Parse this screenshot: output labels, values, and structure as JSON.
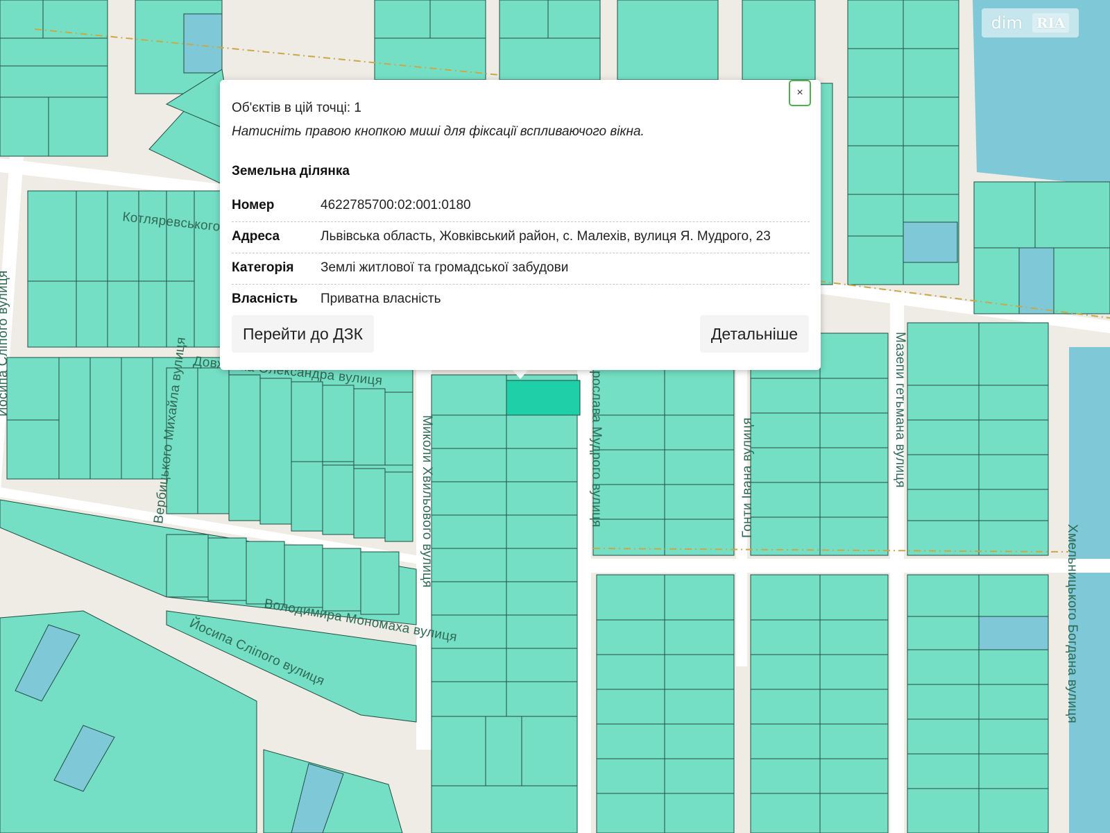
{
  "map": {
    "streets": [
      "Котляревського",
      "Довженка Олександра вулиця",
      "Вербицького Михайла вулиця",
      "Йосипа Сліпого вулиця",
      "Миколи Хвильового вулиця",
      "Володимира Мономаха вулиця",
      "Йосипа Сліпого вулиця",
      "Ярослава Мудрого вулиця",
      "Гонти Івана вулиця",
      "Мазепи гетьмана вулиця",
      "Хмельницького Богдана вулиця"
    ],
    "colors": {
      "parcel": "#75dfc5",
      "selected_parcel": "#1ecfa8",
      "water_parcel": "#7ec8d8",
      "road": "#ffffff",
      "background": "#efebe5"
    }
  },
  "logo": {
    "left": "dim",
    "right": "RIA"
  },
  "popup": {
    "close_label": "×",
    "count_text": "Об'єктів в цій точці: 1",
    "hint_text": "Натисніть правою кнопкою миші для фіксації вспливаючого вікна.",
    "title": "Земельна ділянка",
    "rows": [
      {
        "key": "Номер",
        "value": "4622785700:02:001:0180"
      },
      {
        "key": "Адреса",
        "value": "Львівська область, Жовківський район, с. Малехів, вулиця Я. Мудрого, 23"
      },
      {
        "key": "Категорія",
        "value": "Землі житлової та громадської забудови"
      },
      {
        "key": "Власність",
        "value": "Приватна власність"
      }
    ],
    "btn_dzk": "Перейти до ДЗК",
    "btn_more": "Детальніше"
  }
}
